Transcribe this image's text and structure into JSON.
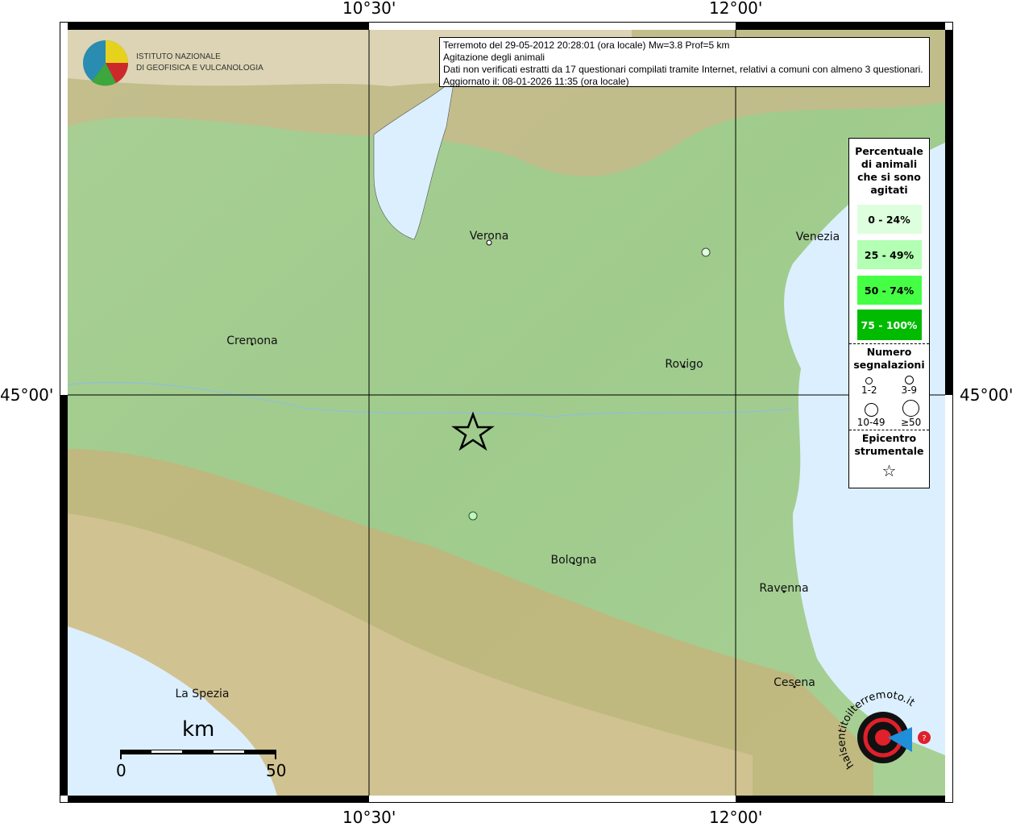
{
  "axes": {
    "top": [
      "10°30'",
      "12°00'"
    ],
    "bottom": [
      "10°30'",
      "12°00'"
    ],
    "left": "45°00'",
    "right": "45°00'"
  },
  "logo_ingv": {
    "line1": "ISTITUTO NAZIONALE",
    "line2": "DI GEOFISICA E VULCANOLOGIA"
  },
  "info": {
    "line1": "Terremoto del 29-05-2012 20:28:01 (ora locale) Mw=3.8 Prof=5 km",
    "line2": "Agitazione degli animali",
    "line3": "Dati non verificati estratti da 17 questionari compilati tramite Internet, relativi a comuni con almeno 3 questionari.",
    "line4": "Aggiornato il: 08-01-2026 11:35 (ora locale)"
  },
  "legend": {
    "title": "Percentuale di animali che si sono agitati",
    "classes": [
      {
        "label": "0 - 24%",
        "color": "#ddffdd"
      },
      {
        "label": "25 - 49%",
        "color": "#b3ffb3"
      },
      {
        "label": "50 - 74%",
        "color": "#44ff44"
      },
      {
        "label": "75 - 100%",
        "color": "#00bb00"
      }
    ],
    "count_title": "Numero segnalazioni",
    "counts": [
      "1-2",
      "3-9",
      "10-49",
      "≥50"
    ],
    "epicenter_title": "Epicentro strumentale"
  },
  "cities": [
    "Verona",
    "Cremona",
    "Rovigo",
    "Bologna",
    "Ravenna",
    "Cesena",
    "La Spezia",
    "Venezia"
  ],
  "observations": [
    {
      "class": "0 - 24%",
      "count": "3-9"
    },
    {
      "class": "25 - 49%",
      "count": "3-9"
    }
  ],
  "scalebar": {
    "unit": "km",
    "min": "0",
    "max": "50"
  },
  "logo_hsit": {
    "text": "www.haisentitoilterremoto.it"
  }
}
